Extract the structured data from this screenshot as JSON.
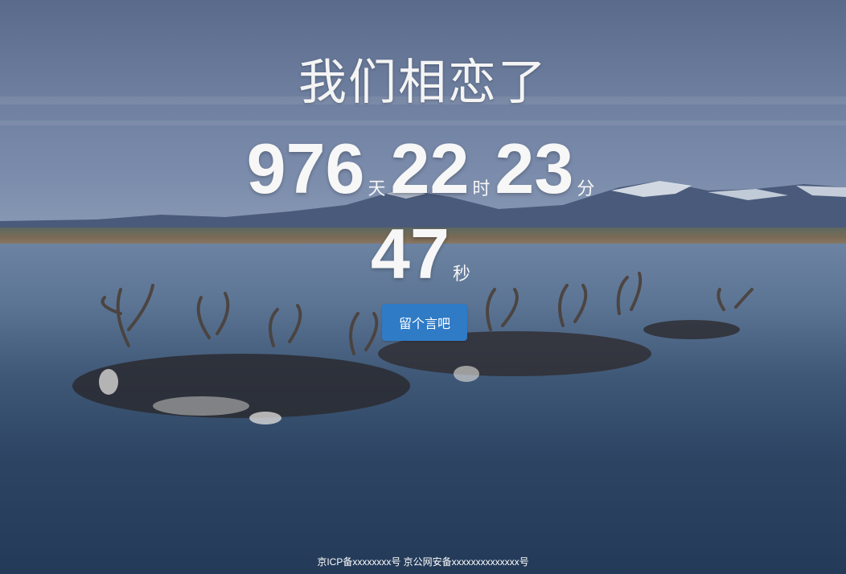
{
  "page": {
    "title": "我们相恋了"
  },
  "counter": {
    "days": "976",
    "days_unit": "天",
    "hours": "22",
    "hours_unit": "时",
    "minutes": "23",
    "minutes_unit": "分",
    "seconds": "47",
    "seconds_unit": "秒"
  },
  "actions": {
    "message_label": "留个言吧"
  },
  "footer": {
    "icp": "京ICP备xxxxxxxx号",
    "police": "京公网安备xxxxxxxxxxxxxx号"
  },
  "colors": {
    "button": "#2f7bc6",
    "text": "#ffffff"
  },
  "background": {
    "scene": "reindeer-herd-swimming-across-river-with-snowy-mountains"
  }
}
